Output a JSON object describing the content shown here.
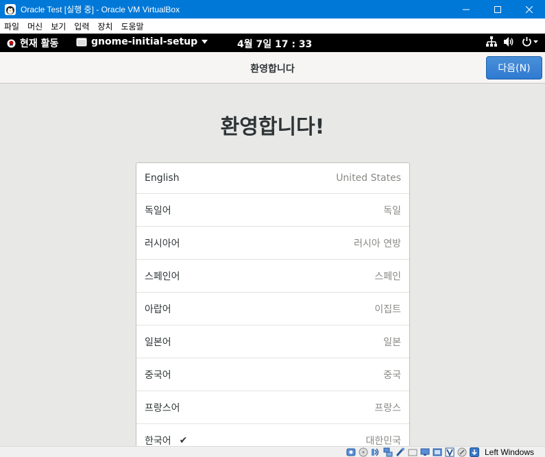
{
  "window": {
    "title": "Oracle Test [실행 중] - Oracle VM VirtualBox"
  },
  "menubar": {
    "items": [
      "파일",
      "머신",
      "보기",
      "입력",
      "장치",
      "도움말"
    ]
  },
  "gnome_topbar": {
    "activities": "현재 활동",
    "app_menu": "gnome-initial-setup",
    "clock": "4월 7일  17 : 33"
  },
  "setup": {
    "header_title": "환영합니다",
    "next_label": "다음(N)",
    "welcome_title": "환영합니다!",
    "languages": [
      {
        "name": "English",
        "region": "United States",
        "selected": false
      },
      {
        "name": "독일어",
        "region": "독일",
        "selected": false
      },
      {
        "name": "러시아어",
        "region": "러시아 연방",
        "selected": false
      },
      {
        "name": "스페인어",
        "region": "스페인",
        "selected": false
      },
      {
        "name": "아랍어",
        "region": "이집트",
        "selected": false
      },
      {
        "name": "일본어",
        "region": "일본",
        "selected": false
      },
      {
        "name": "중국어",
        "region": "중국",
        "selected": false
      },
      {
        "name": "프랑스어",
        "region": "프랑스",
        "selected": false
      },
      {
        "name": "한국어",
        "region": "대한민국",
        "selected": true
      }
    ]
  },
  "statusbar": {
    "host_key": "Left Windows",
    "icons": [
      "hard-disk-icon",
      "optical-drive-icon",
      "audio-icon",
      "network-icon",
      "usb-icon",
      "shared-folder-icon",
      "display-icon",
      "video-capture-icon",
      "virtualization-icon",
      "mouse-integration-icon",
      "host-key-arrow-icon"
    ]
  },
  "colors": {
    "titlebar": "#0078d7",
    "accent_button": "#3584e4",
    "content_bg": "#e8e8e7"
  }
}
